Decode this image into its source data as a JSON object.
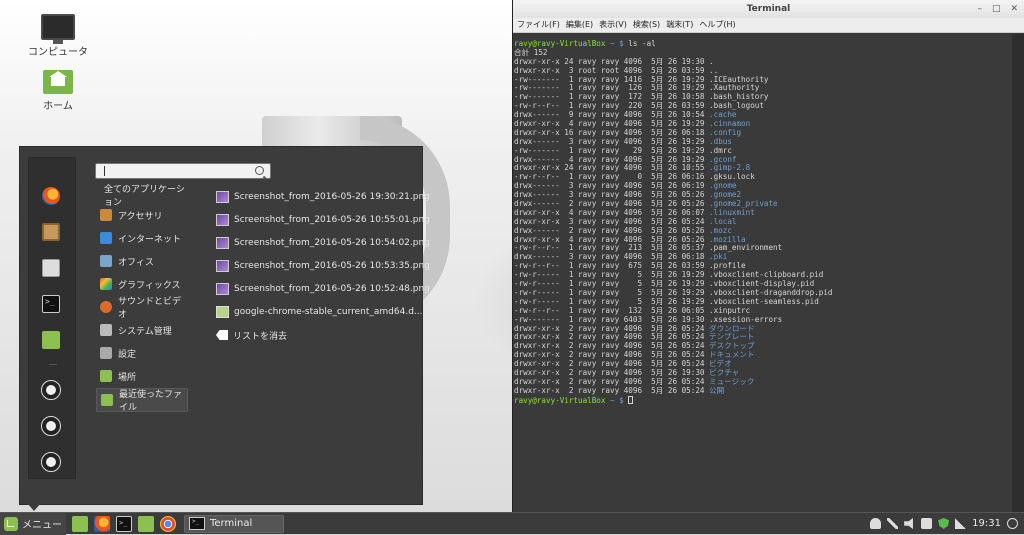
{
  "desktop": {
    "icons": [
      {
        "label": "コンピュータ",
        "icon": "computer-icon"
      },
      {
        "label": "ホーム",
        "icon": "home-folder-icon"
      }
    ]
  },
  "menu": {
    "search_value": "",
    "categories": [
      {
        "label": "全てのアプリケーション",
        "color": ""
      },
      {
        "label": "アクセサリ",
        "color": "#c98a3c"
      },
      {
        "label": "インターネット",
        "color": "#3d8ad8"
      },
      {
        "label": "オフィス",
        "color": "#7aa6c9"
      },
      {
        "label": "グラフィックス",
        "color": "#d23c8a"
      },
      {
        "label": "サウンドとビデオ",
        "color": "#dd6a2a"
      },
      {
        "label": "システム管理",
        "color": "#bbbbbb"
      },
      {
        "label": "設定",
        "color": "#aaaaaa"
      },
      {
        "label": "場所",
        "color": "#8cc152"
      },
      {
        "label": "最近使ったファイル",
        "color": "#8cc152"
      }
    ],
    "recent": [
      "Screenshot_from_2016-05-26 19:30:21.png",
      "Screenshot_from_2016-05-26 10:55:01.png",
      "Screenshot_from_2016-05-26 10:54:02.png",
      "Screenshot_from_2016-05-26 10:53:35.png",
      "Screenshot_from_2016-05-26 10:52:48.png",
      "google-chrome-stable_current_amd64.d..."
    ],
    "clear_label": "リストを消去"
  },
  "terminal": {
    "title": "Terminal",
    "menu": [
      "ファイル(F)",
      "編集(E)",
      "表示(V)",
      "検索(S)",
      "端末(T)",
      "ヘルプ(H)"
    ],
    "prompt_host": "ravy@ravy-VirtualBox",
    "prompt_path": " ~ $ ",
    "command": "ls -al",
    "total": "合計 152",
    "entries": [
      {
        "meta": "drwxr-xr-x 24 ravy ravy 4096  5月 26 19:30 ",
        "name": ".",
        "color": "n"
      },
      {
        "meta": "drwxr-xr-x  3 root root 4096  5月 26 03:59 ",
        "name": "..",
        "color": "n"
      },
      {
        "meta": "-rw-------  1 ravy ravy 1416  5月 26 19:29 ",
        "name": ".ICEauthority",
        "color": "n"
      },
      {
        "meta": "-rw-------  1 ravy ravy  126  5月 26 19:29 ",
        "name": ".Xauthority",
        "color": "n"
      },
      {
        "meta": "-rw-------  1 ravy ravy  172  5月 26 10:58 ",
        "name": ".bash_history",
        "color": "n"
      },
      {
        "meta": "-rw-r--r--  1 ravy ravy  220  5月 26 03:59 ",
        "name": ".bash_logout",
        "color": "n"
      },
      {
        "meta": "drwx------  9 ravy ravy 4096  5月 26 10:54 ",
        "name": ".cache",
        "color": "b"
      },
      {
        "meta": "drwxr-xr-x  4 ravy ravy 4096  5月 26 19:29 ",
        "name": ".cinnamon",
        "color": "b"
      },
      {
        "meta": "drwxr-xr-x 16 ravy ravy 4096  5月 26 06:18 ",
        "name": ".config",
        "color": "b"
      },
      {
        "meta": "drwx------  3 ravy ravy 4096  5月 26 19:29 ",
        "name": ".dbus",
        "color": "b"
      },
      {
        "meta": "-rw-------  1 ravy ravy   29  5月 26 19:29 ",
        "name": ".dmrc",
        "color": "n"
      },
      {
        "meta": "drwx------  4 ravy ravy 4096  5月 26 19:29 ",
        "name": ".gconf",
        "color": "b"
      },
      {
        "meta": "drwxr-xr-x 24 ravy ravy 4096  5月 26 10:55 ",
        "name": ".gimp-2.8",
        "color": "b"
      },
      {
        "meta": "-rw-r--r--  1 ravy ravy    0  5月 26 06:16 ",
        "name": ".gksu.lock",
        "color": "n"
      },
      {
        "meta": "drwx------  3 ravy ravy 4096  5月 26 06:19 ",
        "name": ".gnome",
        "color": "b"
      },
      {
        "meta": "drwx------  3 ravy ravy 4096  5月 26 05:26 ",
        "name": ".gnome2",
        "color": "b"
      },
      {
        "meta": "drwx------  2 ravy ravy 4096  5月 26 05:26 ",
        "name": ".gnome2_private",
        "color": "b"
      },
      {
        "meta": "drwxr-xr-x  4 ravy ravy 4096  5月 26 06:07 ",
        "name": ".linuxmint",
        "color": "b"
      },
      {
        "meta": "drwxr-xr-x  3 ravy ravy 4096  5月 26 05:24 ",
        "name": ".local",
        "color": "b"
      },
      {
        "meta": "drwx------  2 ravy ravy 4096  5月 26 05:26 ",
        "name": ".mozc",
        "color": "b"
      },
      {
        "meta": "drwxr-xr-x  4 ravy ravy 4096  5月 26 05:26 ",
        "name": ".mozilla",
        "color": "b"
      },
      {
        "meta": "-rw-r--r--  1 ravy ravy  213  5月 26 05:37 ",
        "name": ".pam_environment",
        "color": "n"
      },
      {
        "meta": "drwx------  3 ravy ravy 4096  5月 26 06:18 ",
        "name": ".pki",
        "color": "b"
      },
      {
        "meta": "-rw-r--r--  1 ravy ravy  675  5月 26 03:59 ",
        "name": ".profile",
        "color": "n"
      },
      {
        "meta": "-rw-r-----  1 ravy ravy    5  5月 26 19:29 ",
        "name": ".vboxclient-clipboard.pid",
        "color": "n"
      },
      {
        "meta": "-rw-r-----  1 ravy ravy    5  5月 26 19:29 ",
        "name": ".vboxclient-display.pid",
        "color": "n"
      },
      {
        "meta": "-rw-r-----  1 ravy ravy    5  5月 26 19:29 ",
        "name": ".vboxclient-draganddrop.pid",
        "color": "n"
      },
      {
        "meta": "-rw-r-----  1 ravy ravy    5  5月 26 19:29 ",
        "name": ".vboxclient-seamless.pid",
        "color": "n"
      },
      {
        "meta": "-rw-r--r--  1 ravy ravy  132  5月 26 06:05 ",
        "name": ".xinputrc",
        "color": "n"
      },
      {
        "meta": "-rw-------  1 ravy ravy 6403  5月 26 19:30 ",
        "name": ".xsession-errors",
        "color": "n"
      },
      {
        "meta": "drwxr-xr-x  2 ravy ravy 4096  5月 26 05:24 ",
        "name": "ダウンロード",
        "color": "b"
      },
      {
        "meta": "drwxr-xr-x  2 ravy ravy 4096  5月 26 05:24 ",
        "name": "テンプレート",
        "color": "b"
      },
      {
        "meta": "drwxr-xr-x  2 ravy ravy 4096  5月 26 05:24 ",
        "name": "デスクトップ",
        "color": "b"
      },
      {
        "meta": "drwxr-xr-x  2 ravy ravy 4096  5月 26 05:24 ",
        "name": "ドキュメント",
        "color": "b"
      },
      {
        "meta": "drwxr-xr-x  2 ravy ravy 4096  5月 26 05:24 ",
        "name": "ビデオ",
        "color": "b"
      },
      {
        "meta": "drwxr-xr-x  2 ravy ravy 4096  5月 26 19:30 ",
        "name": "ピクチャ",
        "color": "b"
      },
      {
        "meta": "drwxr-xr-x  2 ravy ravy 4096  5月 26 05:24 ",
        "name": "ミュージック",
        "color": "b"
      },
      {
        "meta": "drwxr-xr-x  2 ravy ravy 4096  5月 26 05:24 ",
        "name": "公開",
        "color": "b"
      }
    ]
  },
  "taskbar": {
    "menu_label": "メニュー",
    "window_label": "Terminal",
    "clock": "19:31"
  }
}
